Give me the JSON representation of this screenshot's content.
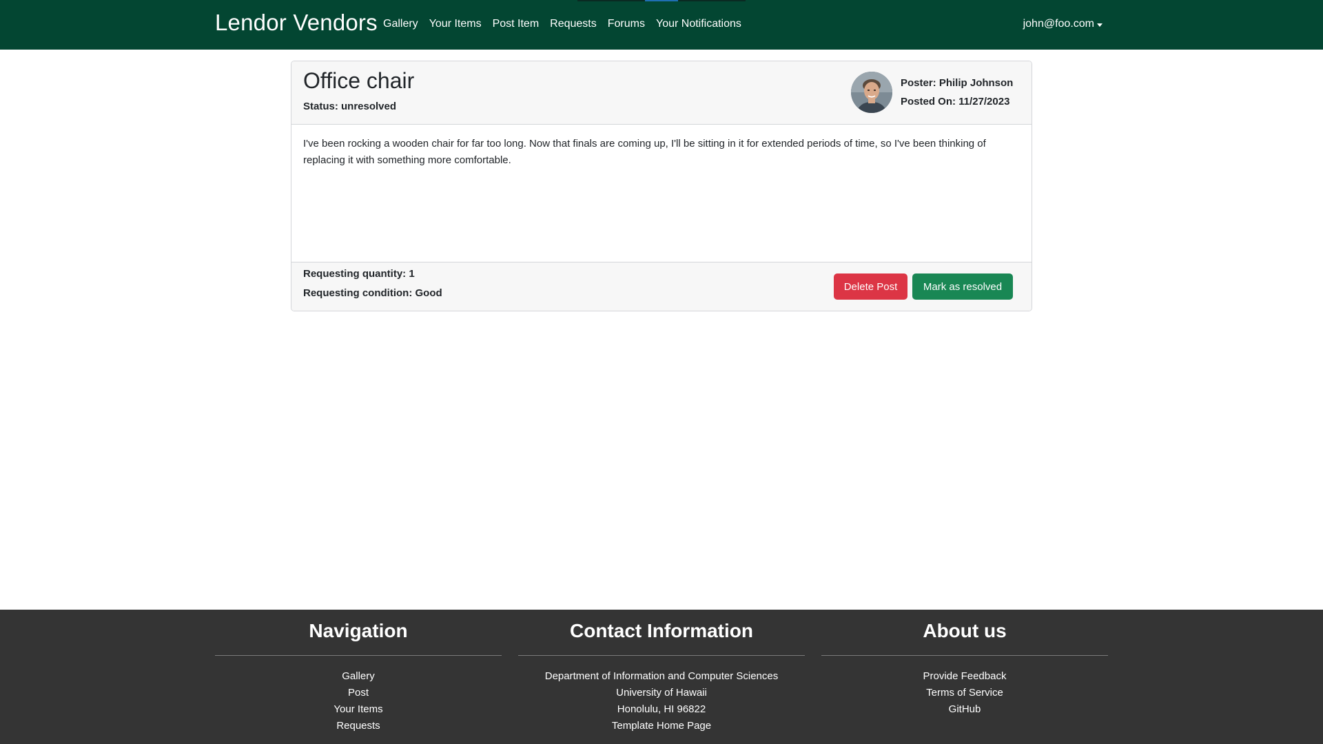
{
  "navbar": {
    "brand": "Lendor Vendors",
    "links": [
      "Gallery",
      "Your Items",
      "Post Item",
      "Requests",
      "Forums",
      "Your Notifications"
    ],
    "user": "john@foo.com",
    "background_color": "#034632"
  },
  "post": {
    "title": "Office chair",
    "status": "Status: unresolved",
    "poster": "Poster: Philip Johnson",
    "posted_on": "Posted On: 11/27/2023",
    "body": "I've been rocking a wooden chair for far too long. Now that finals are coming up, I'll be sitting in it for extended periods of time, so I've been thinking of replacing it with something more comfortable.",
    "requesting_quantity": "Requesting quantity: 1",
    "requesting_condition": "Requesting condition: Good",
    "delete_label": "Delete Post",
    "resolve_label": "Mark as resolved",
    "delete_color": "#dc3545",
    "resolve_color": "#198754"
  },
  "footer": {
    "navigation": {
      "heading": "Navigation",
      "items": [
        "Gallery",
        "Post",
        "Your Items",
        "Requests"
      ]
    },
    "contact": {
      "heading": "Contact Information",
      "items": [
        "Department of Information and Computer Sciences",
        "University of Hawaii",
        "Honolulu, HI 96822",
        "Template Home Page"
      ]
    },
    "about": {
      "heading": "About us",
      "items": [
        "Provide Feedback",
        "Terms of Service",
        "GitHub"
      ]
    },
    "background_color": "#343434"
  }
}
